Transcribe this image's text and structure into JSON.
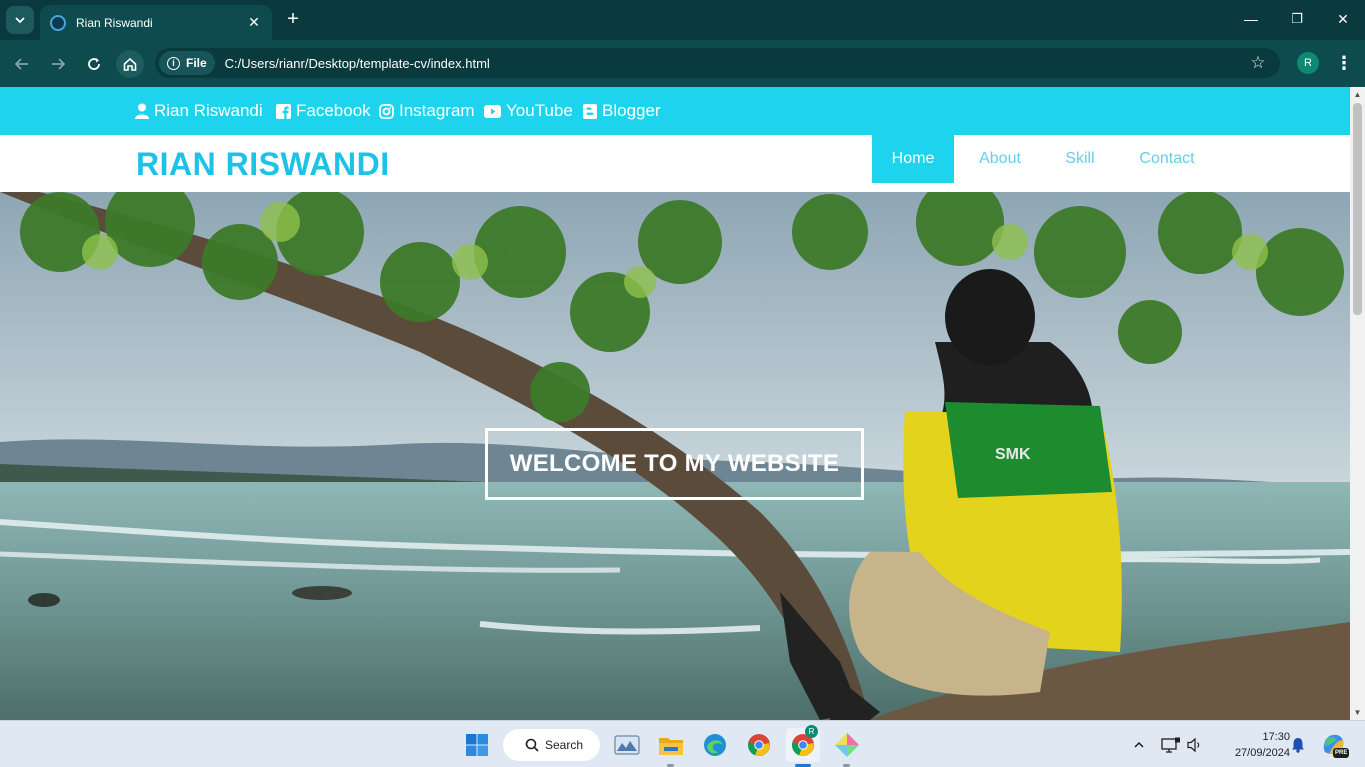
{
  "browser": {
    "tab_title": "Rian Riswandi",
    "tab_close": "✕",
    "new_tab": "+",
    "address_chip": "File",
    "url": "C:/Users/rianr/Desktop/template-cv/index.html",
    "profile_initial": "R",
    "menu_glyph": "⋮",
    "bookmark_glyph": "☆",
    "minimize": "—",
    "restore": "❐",
    "close": "✕"
  },
  "site": {
    "social": [
      {
        "label": "Rian Riswandi",
        "icon": "user-icon"
      },
      {
        "label": "Facebook",
        "icon": "facebook-icon"
      },
      {
        "label": "Instagram",
        "icon": "instagram-icon"
      },
      {
        "label": "YouTube",
        "icon": "youtube-icon"
      },
      {
        "label": "Blogger",
        "icon": "blogger-icon"
      }
    ],
    "brand": "RIAN RISWANDI",
    "nav": [
      {
        "label": "Home",
        "active": true
      },
      {
        "label": "About",
        "active": false
      },
      {
        "label": "Skill",
        "active": false
      },
      {
        "label": "Contact",
        "active": false
      }
    ],
    "hero_text": "WELCOME TO MY WEBSITE",
    "shirt_text": "SMK",
    "colors": {
      "accent": "#1dd3ee",
      "brand": "#1dc3e6",
      "nav_text": "#64cfe9"
    }
  },
  "taskbar": {
    "search_label": "Search",
    "time": "17:30",
    "date": "27/09/2024",
    "apps": [
      "start-icon",
      "widgets-icon",
      "file-explorer-icon",
      "edge-icon",
      "chrome-icon",
      "chrome-profile-icon",
      "gemini-icon"
    ],
    "profile_badge": "R",
    "copilot_badge": "PRE"
  }
}
